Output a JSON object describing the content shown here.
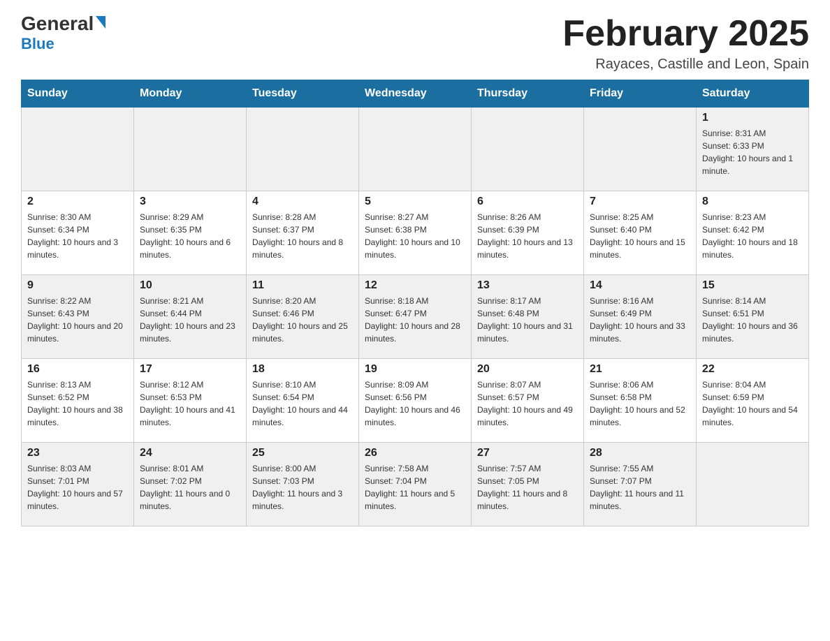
{
  "logo": {
    "text1": "General",
    "text2": "Blue"
  },
  "header": {
    "title": "February 2025",
    "location": "Rayaces, Castille and Leon, Spain"
  },
  "days_of_week": [
    "Sunday",
    "Monday",
    "Tuesday",
    "Wednesday",
    "Thursday",
    "Friday",
    "Saturday"
  ],
  "weeks": [
    [
      {
        "day": "",
        "info": ""
      },
      {
        "day": "",
        "info": ""
      },
      {
        "day": "",
        "info": ""
      },
      {
        "day": "",
        "info": ""
      },
      {
        "day": "",
        "info": ""
      },
      {
        "day": "",
        "info": ""
      },
      {
        "day": "1",
        "info": "Sunrise: 8:31 AM\nSunset: 6:33 PM\nDaylight: 10 hours and 1 minute."
      }
    ],
    [
      {
        "day": "2",
        "info": "Sunrise: 8:30 AM\nSunset: 6:34 PM\nDaylight: 10 hours and 3 minutes."
      },
      {
        "day": "3",
        "info": "Sunrise: 8:29 AM\nSunset: 6:35 PM\nDaylight: 10 hours and 6 minutes."
      },
      {
        "day": "4",
        "info": "Sunrise: 8:28 AM\nSunset: 6:37 PM\nDaylight: 10 hours and 8 minutes."
      },
      {
        "day": "5",
        "info": "Sunrise: 8:27 AM\nSunset: 6:38 PM\nDaylight: 10 hours and 10 minutes."
      },
      {
        "day": "6",
        "info": "Sunrise: 8:26 AM\nSunset: 6:39 PM\nDaylight: 10 hours and 13 minutes."
      },
      {
        "day": "7",
        "info": "Sunrise: 8:25 AM\nSunset: 6:40 PM\nDaylight: 10 hours and 15 minutes."
      },
      {
        "day": "8",
        "info": "Sunrise: 8:23 AM\nSunset: 6:42 PM\nDaylight: 10 hours and 18 minutes."
      }
    ],
    [
      {
        "day": "9",
        "info": "Sunrise: 8:22 AM\nSunset: 6:43 PM\nDaylight: 10 hours and 20 minutes."
      },
      {
        "day": "10",
        "info": "Sunrise: 8:21 AM\nSunset: 6:44 PM\nDaylight: 10 hours and 23 minutes."
      },
      {
        "day": "11",
        "info": "Sunrise: 8:20 AM\nSunset: 6:46 PM\nDaylight: 10 hours and 25 minutes."
      },
      {
        "day": "12",
        "info": "Sunrise: 8:18 AM\nSunset: 6:47 PM\nDaylight: 10 hours and 28 minutes."
      },
      {
        "day": "13",
        "info": "Sunrise: 8:17 AM\nSunset: 6:48 PM\nDaylight: 10 hours and 31 minutes."
      },
      {
        "day": "14",
        "info": "Sunrise: 8:16 AM\nSunset: 6:49 PM\nDaylight: 10 hours and 33 minutes."
      },
      {
        "day": "15",
        "info": "Sunrise: 8:14 AM\nSunset: 6:51 PM\nDaylight: 10 hours and 36 minutes."
      }
    ],
    [
      {
        "day": "16",
        "info": "Sunrise: 8:13 AM\nSunset: 6:52 PM\nDaylight: 10 hours and 38 minutes."
      },
      {
        "day": "17",
        "info": "Sunrise: 8:12 AM\nSunset: 6:53 PM\nDaylight: 10 hours and 41 minutes."
      },
      {
        "day": "18",
        "info": "Sunrise: 8:10 AM\nSunset: 6:54 PM\nDaylight: 10 hours and 44 minutes."
      },
      {
        "day": "19",
        "info": "Sunrise: 8:09 AM\nSunset: 6:56 PM\nDaylight: 10 hours and 46 minutes."
      },
      {
        "day": "20",
        "info": "Sunrise: 8:07 AM\nSunset: 6:57 PM\nDaylight: 10 hours and 49 minutes."
      },
      {
        "day": "21",
        "info": "Sunrise: 8:06 AM\nSunset: 6:58 PM\nDaylight: 10 hours and 52 minutes."
      },
      {
        "day": "22",
        "info": "Sunrise: 8:04 AM\nSunset: 6:59 PM\nDaylight: 10 hours and 54 minutes."
      }
    ],
    [
      {
        "day": "23",
        "info": "Sunrise: 8:03 AM\nSunset: 7:01 PM\nDaylight: 10 hours and 57 minutes."
      },
      {
        "day": "24",
        "info": "Sunrise: 8:01 AM\nSunset: 7:02 PM\nDaylight: 11 hours and 0 minutes."
      },
      {
        "day": "25",
        "info": "Sunrise: 8:00 AM\nSunset: 7:03 PM\nDaylight: 11 hours and 3 minutes."
      },
      {
        "day": "26",
        "info": "Sunrise: 7:58 AM\nSunset: 7:04 PM\nDaylight: 11 hours and 5 minutes."
      },
      {
        "day": "27",
        "info": "Sunrise: 7:57 AM\nSunset: 7:05 PM\nDaylight: 11 hours and 8 minutes."
      },
      {
        "day": "28",
        "info": "Sunrise: 7:55 AM\nSunset: 7:07 PM\nDaylight: 11 hours and 11 minutes."
      },
      {
        "day": "",
        "info": ""
      }
    ]
  ]
}
